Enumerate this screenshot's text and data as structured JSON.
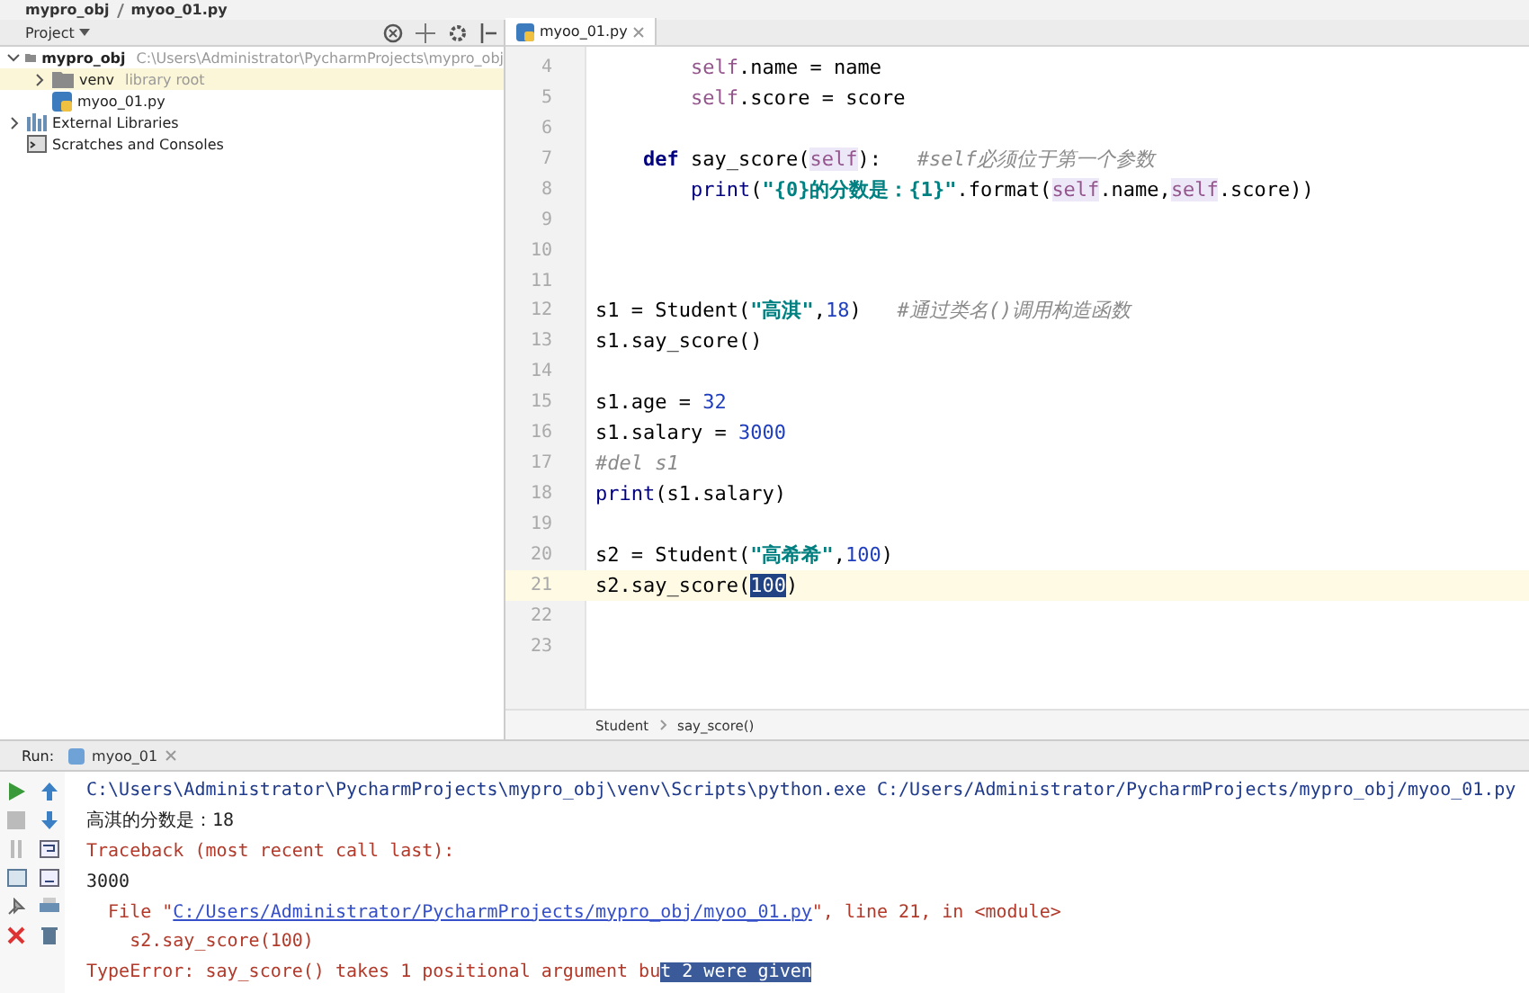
{
  "title_bar": {
    "crumbs": [
      "mypro_obj",
      "myoo_01.py"
    ]
  },
  "project_panel": {
    "title": "Project",
    "tree": [
      {
        "label": "mypro_obj",
        "hint": "C:\\Users\\Administrator\\PycharmProjects\\mypro_obj",
        "kind": "folder",
        "expanded": true,
        "selected": false,
        "children": [
          {
            "label": "venv",
            "hint": "library root",
            "kind": "folder",
            "expanded": false,
            "selected": true
          },
          {
            "label": "myoo_01.py",
            "kind": "file",
            "selected": false
          }
        ]
      },
      {
        "label": "External Libraries",
        "kind": "libs",
        "expanded": false,
        "selected": false
      },
      {
        "label": "Scratches and Consoles",
        "kind": "scratch",
        "selected": false
      }
    ]
  },
  "editor": {
    "tab": "myoo_01.py",
    "lines": [
      {
        "num": "4",
        "current": false,
        "tokens": [
          {
            "kind": "self",
            "text": "        self"
          },
          {
            "kind": "plain",
            "text": ".name = name"
          }
        ]
      },
      {
        "num": "5",
        "current": false,
        "tokens": [
          {
            "kind": "self",
            "text": "        self"
          },
          {
            "kind": "plain",
            "text": ".score = score"
          }
        ]
      },
      {
        "num": "6",
        "current": false
      },
      {
        "num": "7",
        "current": false,
        "tokens": [
          {
            "kind": "keyword",
            "text": "    def"
          },
          {
            "kind": "plain",
            "text": " say_score("
          },
          {
            "kind": "self_param",
            "text": "self"
          },
          {
            "kind": "plain",
            "text": "):   "
          },
          {
            "kind": "comment",
            "text": "#self必须位于第一个参数"
          }
        ]
      },
      {
        "num": "8",
        "current": false,
        "tokens": [
          {
            "kind": "builtin",
            "text": "        print"
          },
          {
            "kind": "plain",
            "text": "("
          },
          {
            "kind": "string",
            "text": "\"{0}的分数是：{1}\""
          },
          {
            "kind": "plain",
            "text": ".format("
          },
          {
            "kind": "self_param",
            "text": "self"
          },
          {
            "kind": "plain",
            "text": ".name,"
          },
          {
            "kind": "self_param",
            "text": "self"
          },
          {
            "kind": "plain",
            "text": ".score))"
          }
        ]
      },
      {
        "num": "9",
        "current": false
      },
      {
        "num": "10",
        "current": false
      },
      {
        "num": "11",
        "current": false
      },
      {
        "num": "12",
        "current": false,
        "tokens": [
          {
            "kind": "plain",
            "text": "s1 = Student("
          },
          {
            "kind": "string",
            "text": "\"高淇\""
          },
          {
            "kind": "plain",
            "text": ","
          },
          {
            "kind": "number",
            "text": "18"
          },
          {
            "kind": "plain",
            "text": ")   "
          },
          {
            "kind": "comment",
            "text": "#通过类名()调用构造函数"
          }
        ]
      },
      {
        "num": "13",
        "current": false,
        "tokens": [
          {
            "kind": "plain",
            "text": "s1.say_score()"
          }
        ]
      },
      {
        "num": "14",
        "current": false
      },
      {
        "num": "15",
        "current": false,
        "tokens": [
          {
            "kind": "plain",
            "text": "s1.age = "
          },
          {
            "kind": "number",
            "text": "32"
          }
        ]
      },
      {
        "num": "16",
        "current": false,
        "tokens": [
          {
            "kind": "plain",
            "text": "s1.salary = "
          },
          {
            "kind": "number",
            "text": "3000"
          }
        ]
      },
      {
        "num": "17",
        "current": false,
        "tokens": [
          {
            "kind": "comment",
            "text": "#del s1"
          }
        ]
      },
      {
        "num": "18",
        "current": false,
        "tokens": [
          {
            "kind": "builtin",
            "text": "print"
          },
          {
            "kind": "plain",
            "text": "(s1.salary)"
          }
        ]
      },
      {
        "num": "19",
        "current": false
      },
      {
        "num": "20",
        "current": false,
        "tokens": [
          {
            "kind": "plain",
            "text": "s2 = Student("
          },
          {
            "kind": "string",
            "text": "\"高希希\""
          },
          {
            "kind": "plain",
            "text": ","
          },
          {
            "kind": "number",
            "text": "100"
          },
          {
            "kind": "plain",
            "text": ")"
          }
        ]
      },
      {
        "num": "21",
        "current": true,
        "tokens": [
          {
            "kind": "plain",
            "text": "s2.say_score("
          },
          {
            "kind": "selection",
            "text": "100"
          },
          {
            "kind": "plain",
            "text": ")"
          }
        ]
      },
      {
        "num": "22",
        "current": false
      },
      {
        "num": "23",
        "current": false
      }
    ],
    "breadcrumb": [
      "Student",
      "say_score()"
    ]
  },
  "run_panel": {
    "label": "Run:",
    "tab": "myoo_01",
    "lines": [
      {
        "segs": [
          {
            "kind": "path",
            "text": "C:\\Users\\Administrator\\PycharmProjects\\mypro_obj\\venv\\Scripts\\python.exe C:/Users/Administrator/PycharmProjects/mypro_obj/myoo_01.py"
          }
        ]
      },
      {
        "segs": [
          {
            "kind": "output",
            "text": "高淇的分数是：18"
          }
        ]
      },
      {
        "segs": [
          {
            "kind": "error",
            "text": "Traceback (most recent call last):"
          }
        ]
      },
      {
        "segs": [
          {
            "kind": "output",
            "text": "3000"
          }
        ]
      },
      {
        "segs": [
          {
            "kind": "error",
            "text": "  File \""
          },
          {
            "kind": "link",
            "text": "C:/Users/Administrator/PycharmProjects/mypro_obj/myoo_01.py"
          },
          {
            "kind": "error",
            "text": "\", line 21, in <module>"
          }
        ]
      },
      {
        "segs": [
          {
            "kind": "error",
            "text": "    s2.say_score(100)"
          }
        ]
      },
      {
        "segs": [
          {
            "kind": "error",
            "text": "TypeError: say_score() takes 1 positional argument bu"
          },
          {
            "kind": "selection",
            "text": "t 2 were given"
          }
        ]
      }
    ]
  }
}
